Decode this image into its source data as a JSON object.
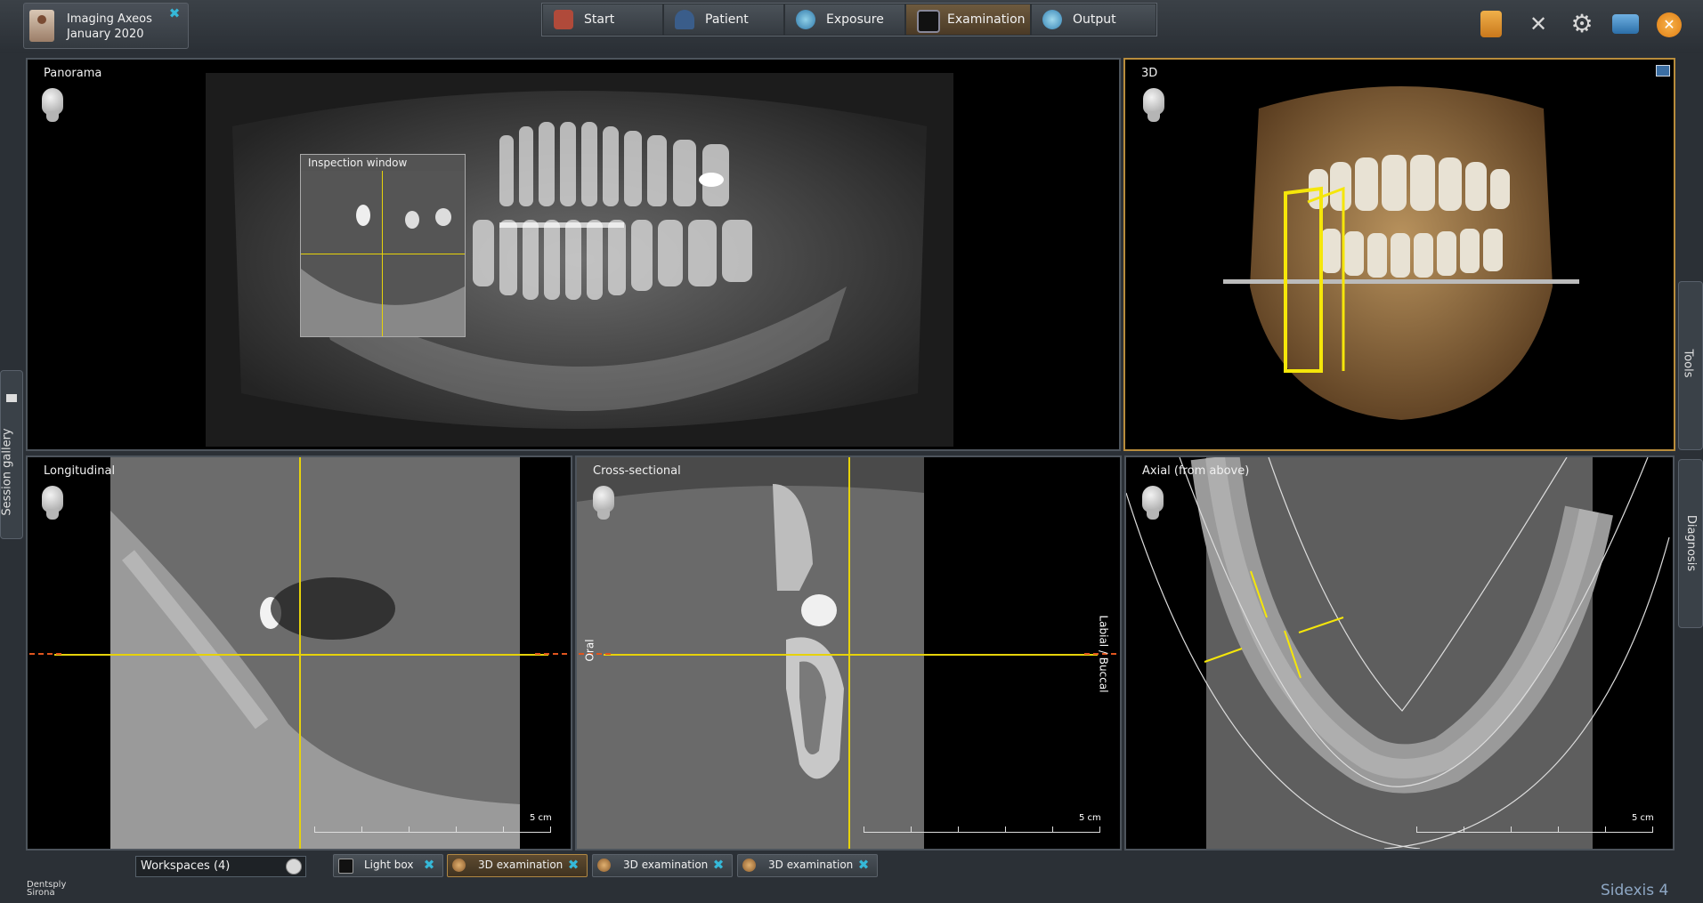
{
  "patient": {
    "name": "Imaging Axeos",
    "date": "January 2020"
  },
  "workflow": [
    {
      "label": "Start",
      "icon": "house-icon"
    },
    {
      "label": "Patient",
      "icon": "person-icon"
    },
    {
      "label": "Exposure",
      "icon": "globe-icon"
    },
    {
      "label": "Examination",
      "icon": "monitor-icon",
      "active": true
    },
    {
      "label": "Output",
      "icon": "globe-icon"
    }
  ],
  "toolbar_icons": [
    "book-icon",
    "tools-icon",
    "gear-icon",
    "windows-icon",
    "close-icon"
  ],
  "side_tabs": {
    "left": "Session gallery",
    "right_top": "Tools",
    "right_bottom": "Diagnosis"
  },
  "panels": {
    "panorama": {
      "title": "Panorama",
      "inspection": "Inspection window"
    },
    "three_d": {
      "title": "3D"
    },
    "longitudinal": {
      "title": "Longitudinal",
      "scale": "5 cm"
    },
    "cross": {
      "title": "Cross-sectional",
      "scale": "5 cm",
      "left_label": "Oral",
      "right_label": "Labial / Buccal"
    },
    "axial": {
      "title": "Axial (from above)",
      "scale": "5 cm"
    }
  },
  "bottom": {
    "workspaces": "Workspaces (4)",
    "tabs": [
      {
        "label": "Light box",
        "active": false
      },
      {
        "label": "3D examination",
        "active": true
      },
      {
        "label": "3D examination",
        "active": false
      },
      {
        "label": "3D examination",
        "active": false
      }
    ],
    "brand_line1": "Dentsply",
    "brand_line2": "Sirona",
    "product": "Sidexis 4"
  },
  "colors": {
    "accent": "#b88c3c",
    "crosshair": "#e6d20a",
    "dashed": "#e0551e",
    "close": "#e8922a"
  }
}
